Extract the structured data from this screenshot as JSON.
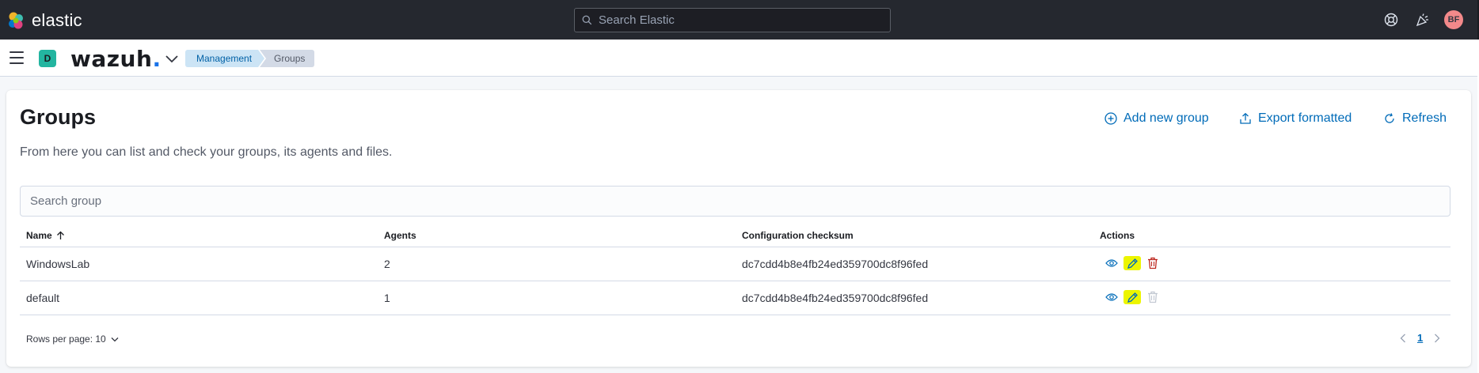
{
  "header": {
    "brand": "elastic",
    "search_placeholder": "Search Elastic",
    "user_initials": "BF",
    "icons": [
      "help-icon",
      "newsfeed-icon"
    ]
  },
  "subbar": {
    "space_initial": "D",
    "app_logo": "wazuh",
    "app_logo_dot": ".",
    "breadcrumbs": [
      "Management",
      "Groups"
    ]
  },
  "page": {
    "title": "Groups",
    "description": "From here you can list and check your groups, its agents and files.",
    "actions": {
      "add": "Add new group",
      "export": "Export formatted",
      "refresh": "Refresh"
    },
    "search_placeholder": "Search group"
  },
  "table": {
    "columns": [
      "Name",
      "Agents",
      "Configuration checksum",
      "Actions"
    ],
    "rows": [
      {
        "name": "WindowsLab",
        "agents": "2",
        "checksum": "dc7cdd4b8e4fb24ed359700dc8f96fed",
        "delete_enabled": true
      },
      {
        "name": "default",
        "agents": "1",
        "checksum": "dc7cdd4b8e4fb24ed359700dc8f96fed",
        "delete_enabled": false
      }
    ]
  },
  "footer": {
    "rows_per_page": "Rows per page: 10",
    "current_page": "1"
  },
  "colors": {
    "header_bg": "#25282f",
    "link": "#006bb8",
    "highlight": "#ecf500",
    "danger": "#bd271e"
  }
}
